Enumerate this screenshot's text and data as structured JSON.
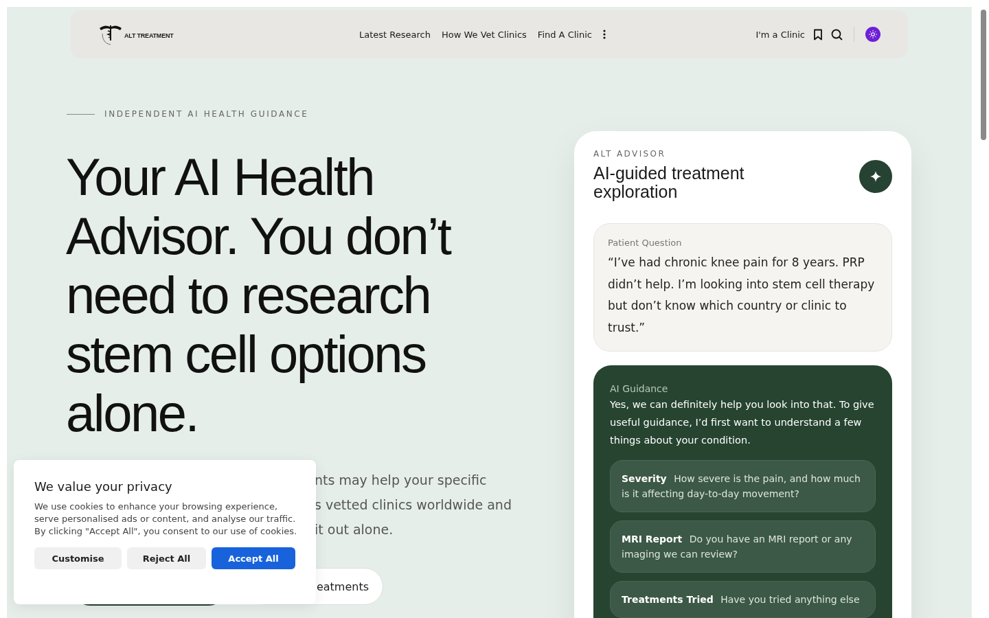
{
  "nav": {
    "logo_text": "ALT TREATMENT",
    "links": [
      {
        "label": "Latest Research"
      },
      {
        "label": "How We Vet Clinics"
      },
      {
        "label": "Find A Clinic"
      }
    ],
    "clinic_link": "I'm a Clinic"
  },
  "hero": {
    "eyebrow": "INDEPENDENT AI HEALTH GUIDANCE",
    "heading": "Your AI Health Advisor. You don’t need to research stem cell options alone.",
    "paragraph_lines": [
      "nts may help your specific",
      "s vetted clinics worldwide and",
      "it out alone."
    ],
    "secondary_button": "eatments"
  },
  "advisor": {
    "eyebrow": "ALT ADVISOR",
    "title": "AI-guided treatment exploration",
    "question": {
      "label": "Patient Question",
      "text": "“I’ve had chronic knee pain for 8 years. PRP didn’t help. I’m looking into stem cell therapy but don’t know which country or clinic to trust.”"
    },
    "guidance": {
      "label": "AI Guidance",
      "text": "Yes, we can definitely help you look into that. To give useful guidance, I’d first want to understand a few things about your condition.",
      "items": [
        {
          "title": "Severity",
          "text": "How severe is the pain, and how much is it affecting day-to-day movement?"
        },
        {
          "title": "MRI Report",
          "text": "Do you have an MRI report or any imaging we can review?"
        },
        {
          "title": "Treatments Tried",
          "text": "Have you tried anything else"
        }
      ]
    }
  },
  "cookie_banner": {
    "title": "We value your privacy",
    "text": "We use cookies to enhance your browsing experience, serve personalised ads or content, and analyse our traffic. By clicking \"Accept All\", you consent to our use of cookies.",
    "buttons": [
      {
        "label": "Customise",
        "kind": "secondary"
      },
      {
        "label": "Reject All",
        "kind": "secondary"
      },
      {
        "label": "Accept All",
        "kind": "primary"
      }
    ]
  }
}
